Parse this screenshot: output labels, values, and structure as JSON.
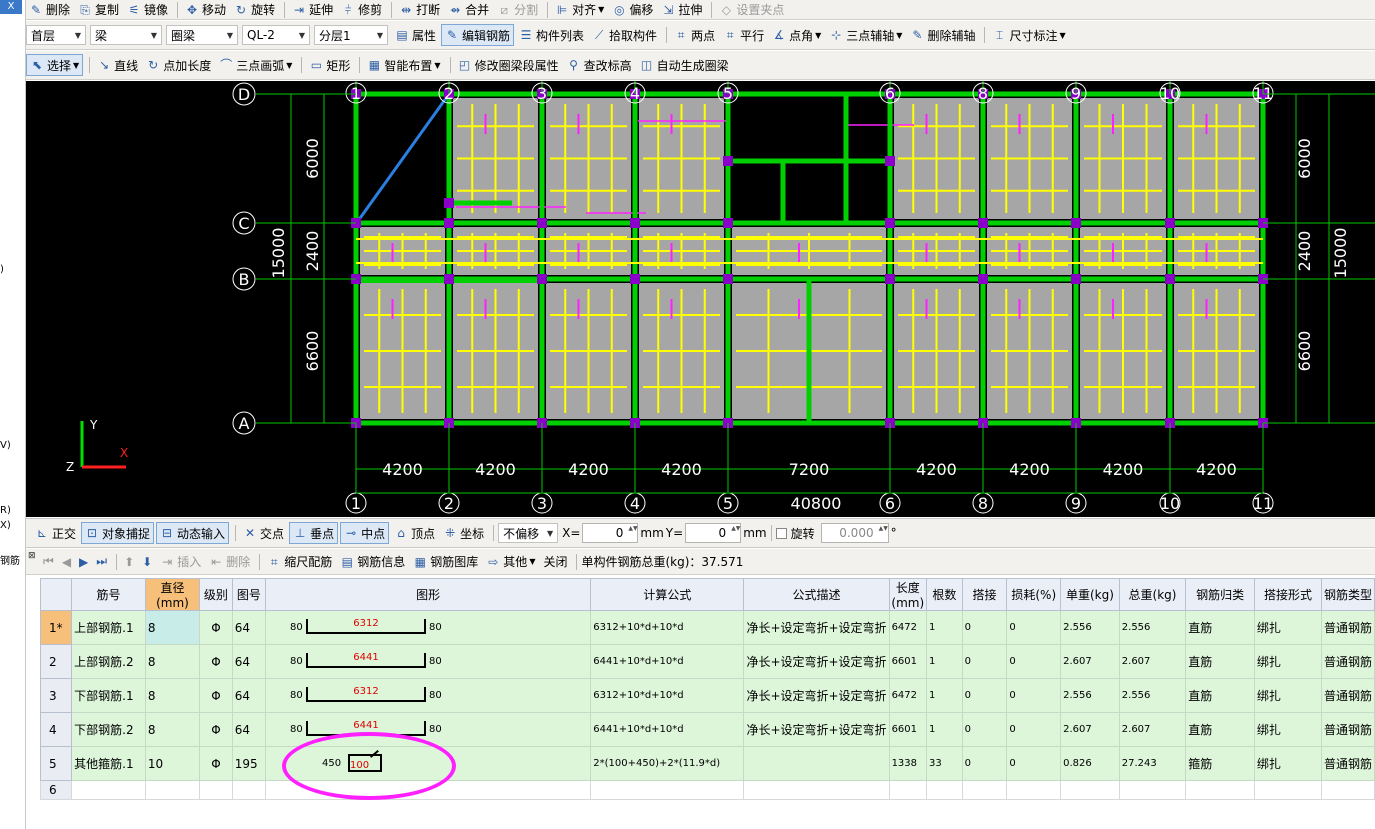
{
  "left_strip": {
    "top_label": "X",
    "marks": [
      ")",
      "V)",
      "R)",
      "X)",
      "钢筋"
    ]
  },
  "toolbar1": {
    "items": [
      {
        "label": "删除",
        "icon": "✎",
        "name": "delete"
      },
      {
        "label": "复制",
        "icon": "⎘",
        "name": "copy"
      },
      {
        "label": "镜像",
        "icon": "⚟",
        "name": "mirror"
      },
      {
        "label": "移动",
        "icon": "✥",
        "name": "move"
      },
      {
        "label": "旋转",
        "icon": "↻",
        "name": "rotate"
      },
      {
        "label": "延伸",
        "icon": "⇥",
        "name": "extend"
      },
      {
        "label": "修剪",
        "icon": "⫩",
        "name": "trim"
      },
      {
        "label": "打断",
        "icon": "⇹",
        "name": "break"
      },
      {
        "label": "合并",
        "icon": "⇴",
        "name": "merge"
      },
      {
        "label": "分割",
        "icon": "⧄",
        "name": "split",
        "disabled": true
      },
      {
        "label": "对齐",
        "icon": "⊫",
        "name": "align",
        "dropdown": true
      },
      {
        "label": "偏移",
        "icon": "◎",
        "name": "offset"
      },
      {
        "label": "拉伸",
        "icon": "⇲",
        "name": "stretch"
      },
      {
        "label": "设置夹点",
        "icon": "◇",
        "name": "set-grip",
        "disabled": true
      }
    ]
  },
  "toolbar2": {
    "selects": {
      "floor": "首层",
      "type": "梁",
      "subtype": "圈梁",
      "member": "QL-2",
      "layer": "分层1"
    },
    "items": [
      {
        "label": "属性",
        "icon": "▤",
        "name": "properties"
      },
      {
        "label": "编辑钢筋",
        "icon": "✎",
        "name": "edit-rebar",
        "active": true
      },
      {
        "label": "构件列表",
        "icon": "☰",
        "name": "component-list"
      },
      {
        "label": "拾取构件",
        "icon": "⟋",
        "name": "pick-component"
      },
      {
        "label": "两点",
        "icon": "⌗",
        "name": "two-point"
      },
      {
        "label": "平行",
        "icon": "⌗",
        "name": "parallel"
      },
      {
        "label": "点角",
        "icon": "∡",
        "name": "point-angle",
        "dropdown": true
      },
      {
        "label": "三点辅轴",
        "icon": "⊹",
        "name": "three-point-axis",
        "dropdown": true
      },
      {
        "label": "删除辅轴",
        "icon": "✎",
        "name": "delete-axis"
      },
      {
        "label": "尺寸标注",
        "icon": "⌶",
        "name": "dimension",
        "dropdown": true
      }
    ]
  },
  "toolbar3": {
    "items": [
      {
        "label": "选择",
        "icon": "⬉",
        "name": "select",
        "active": true,
        "dropdown": true
      },
      {
        "label": "直线",
        "icon": "↘",
        "name": "line"
      },
      {
        "label": "点加长度",
        "icon": "↻",
        "name": "point-length"
      },
      {
        "label": "三点画弧",
        "icon": "⌒",
        "name": "three-point-arc",
        "dropdown": true
      },
      {
        "label": "矩形",
        "icon": "▭",
        "name": "rectangle"
      },
      {
        "label": "智能布置",
        "icon": "▦",
        "name": "smart-layout",
        "dropdown": true
      },
      {
        "label": "修改圈梁段属性",
        "icon": "◰",
        "name": "modify-segment"
      },
      {
        "label": "查改标高",
        "icon": "⚲",
        "name": "check-elevation"
      },
      {
        "label": "自动生成圈梁",
        "icon": "◫",
        "name": "auto-generate"
      }
    ]
  },
  "drawing": {
    "top_axes": [
      "1",
      "2",
      "3",
      "4",
      "5",
      "6",
      "8",
      "9",
      "10",
      "11"
    ],
    "bottom_axes": [
      "1",
      "2",
      "3",
      "4",
      "5",
      "6",
      "8",
      "9",
      "10",
      "11"
    ],
    "row_axes": [
      "D",
      "C",
      "B",
      "A"
    ],
    "bay_dims": [
      "4200",
      "4200",
      "4200",
      "4200",
      "7200",
      "4200",
      "4200",
      "4200",
      "4200"
    ],
    "total_dim": "40800",
    "left_dims": [
      "6000",
      "2400",
      "6600"
    ],
    "left_total": "15000",
    "right_dims": [
      "6000",
      "2400",
      "6600"
    ],
    "right_total": "15000",
    "ucs": {
      "x": "X",
      "y": "Y",
      "z": "Z"
    },
    "colors": {
      "slab": "#a6a6a6",
      "beam": "#00d000",
      "rebar": "#ffff00",
      "rebar_alt": "#ff20ff",
      "column": "#8a00c8",
      "axis": "#00c800",
      "text": "#ffffff"
    }
  },
  "statusbar": {
    "items": [
      {
        "label": "正交",
        "icon": "⊾",
        "name": "ortho"
      },
      {
        "label": "对象捕捉",
        "icon": "⊡",
        "name": "object-snap",
        "active": true
      },
      {
        "label": "动态输入",
        "icon": "⊟",
        "name": "dynamic-input",
        "active": true
      },
      {
        "label": "交点",
        "icon": "✕",
        "name": "snap-intersection"
      },
      {
        "label": "垂点",
        "icon": "⊥",
        "name": "snap-perpendicular",
        "active": true
      },
      {
        "label": "中点",
        "icon": "⊸",
        "name": "snap-midpoint",
        "active": true
      },
      {
        "label": "顶点",
        "icon": "⌂",
        "name": "snap-vertex"
      },
      {
        "label": "坐标",
        "icon": "⁜",
        "name": "snap-coordinate"
      }
    ],
    "offset_mode": "不偏移",
    "x_label": "X=",
    "x_value": "0",
    "x_unit": "mm",
    "y_label": "Y=",
    "y_value": "0",
    "y_unit": "mm",
    "rotate_label": "旋转",
    "rotate_value": "0.000",
    "degree": "°"
  },
  "rebar_toolbar": {
    "items": [
      {
        "label": "插入",
        "icon": "⇥",
        "name": "insert",
        "disabled": true
      },
      {
        "label": "删除",
        "icon": "⇤",
        "name": "delete-row",
        "disabled": true
      },
      {
        "label": "缩尺配筋",
        "icon": "⌗",
        "name": "scale-rebar"
      },
      {
        "label": "钢筋信息",
        "icon": "▤",
        "name": "rebar-info"
      },
      {
        "label": "钢筋图库",
        "icon": "▦",
        "name": "rebar-library"
      },
      {
        "label": "其他",
        "icon": "⇨",
        "name": "other",
        "dropdown": true
      },
      {
        "label": "关闭",
        "icon": "",
        "name": "close"
      }
    ],
    "total_weight": "单构件钢筋总重(kg)：37.571"
  },
  "rebar_table": {
    "headers": [
      "筋号",
      "直径(mm)",
      "级别",
      "图号",
      "图形",
      "计算公式",
      "公式描述",
      "长度(mm)",
      "根数",
      "搭接",
      "损耗(%)",
      "单重(kg)",
      "总重(kg)",
      "钢筋归类",
      "搭接形式",
      "钢筋类型"
    ],
    "rows": [
      {
        "num": "1*",
        "name": "上部钢筋.1",
        "dia": "8",
        "grade": "Φ",
        "fig": "64",
        "left": "80",
        "mid": "6312",
        "right": "80",
        "formula": "6312+10*d+10*d",
        "desc": "净长+设定弯折+设定弯折",
        "len": "6472",
        "count": "1",
        "lap": "0",
        "loss": "0",
        "unit": "2.556",
        "total": "2.556",
        "cat": "直筋",
        "lapform": "绑扎",
        "rtype": "普通钢筋"
      },
      {
        "num": "2",
        "name": "上部钢筋.2",
        "dia": "8",
        "grade": "Φ",
        "fig": "64",
        "left": "80",
        "mid": "6441",
        "right": "80",
        "formula": "6441+10*d+10*d",
        "desc": "净长+设定弯折+设定弯折",
        "len": "6601",
        "count": "1",
        "lap": "0",
        "loss": "0",
        "unit": "2.607",
        "total": "2.607",
        "cat": "直筋",
        "lapform": "绑扎",
        "rtype": "普通钢筋"
      },
      {
        "num": "3",
        "name": "下部钢筋.1",
        "dia": "8",
        "grade": "Φ",
        "fig": "64",
        "left": "80",
        "mid": "6312",
        "right": "80",
        "formula": "6312+10*d+10*d",
        "desc": "净长+设定弯折+设定弯折",
        "len": "6472",
        "count": "1",
        "lap": "0",
        "loss": "0",
        "unit": "2.556",
        "total": "2.556",
        "cat": "直筋",
        "lapform": "绑扎",
        "rtype": "普通钢筋"
      },
      {
        "num": "4",
        "name": "下部钢筋.2",
        "dia": "8",
        "grade": "Φ",
        "fig": "64",
        "left": "80",
        "mid": "6441",
        "right": "80",
        "formula": "6441+10*d+10*d",
        "desc": "净长+设定弯折+设定弯折",
        "len": "6601",
        "count": "1",
        "lap": "0",
        "loss": "0",
        "unit": "2.607",
        "total": "2.607",
        "cat": "直筋",
        "lapform": "绑扎",
        "rtype": "普通钢筋"
      },
      {
        "num": "5",
        "name": "其他箍筋.1",
        "dia": "10",
        "grade": "Φ",
        "fig": "195",
        "left": "450",
        "mid": "100",
        "right": "",
        "formula": "2*(100+450)+2*(11.9*d)",
        "desc": "",
        "len": "1338",
        "count": "33",
        "lap": "0",
        "loss": "0",
        "unit": "0.826",
        "total": "27.243",
        "cat": "箍筋",
        "lapform": "绑扎",
        "rtype": "普通钢筋"
      }
    ],
    "blank_row_num": "6"
  }
}
